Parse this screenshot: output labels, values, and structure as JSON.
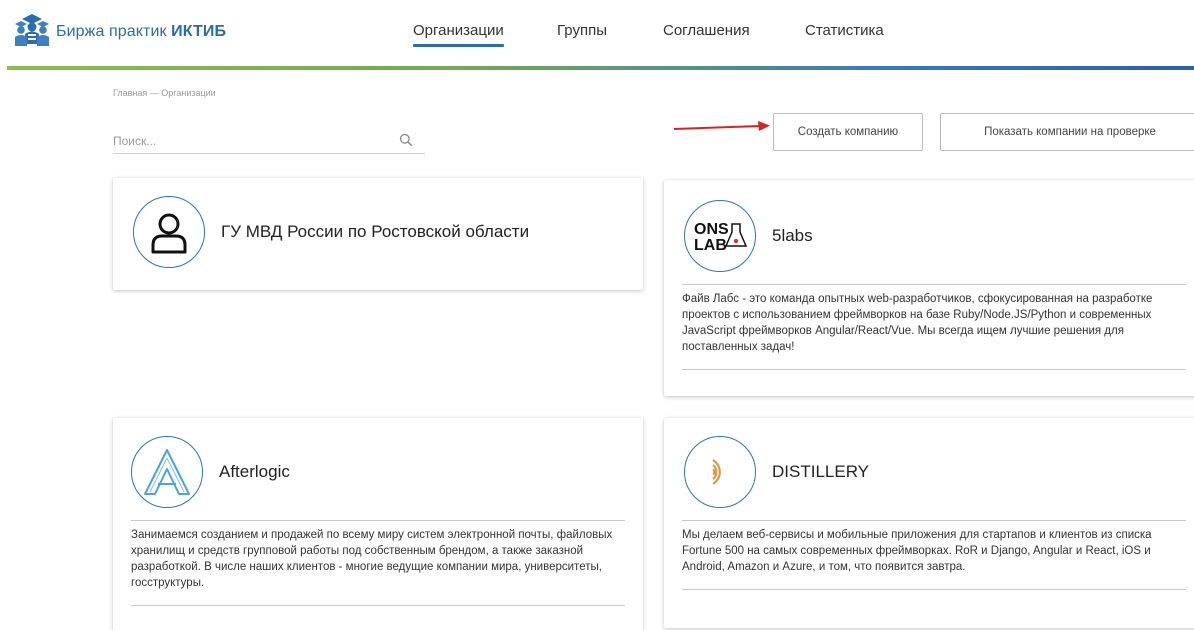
{
  "header": {
    "logo_text_regular": "Биржа практик ",
    "logo_text_bold": "ИКТИБ",
    "logo_icon": "students-group-icon",
    "nav": [
      {
        "label": "Организации",
        "active": true
      },
      {
        "label": "Группы",
        "active": false
      },
      {
        "label": "Соглашения",
        "active": false
      },
      {
        "label": "Статистика",
        "active": false
      }
    ],
    "colors": {
      "brand": "#2b6cb0",
      "line_start": "#8bbf48",
      "line_end": "#2c5fa8"
    }
  },
  "breadcrumb": "Главная — Организации",
  "search": {
    "placeholder": "Поиск...",
    "value": "",
    "icon": "search-icon"
  },
  "actions": {
    "create_label": "Создать компанию",
    "show_review_label": "Показать компании на проверке",
    "arrow_color": "#e02020"
  },
  "organizations": [
    {
      "name": "ГУ МВД России по Ростовской области",
      "logo": "user-placeholder-icon",
      "description": ""
    },
    {
      "name": "5labs",
      "logo": "5labs-logo",
      "logo_text_top": "ONS",
      "logo_text_bottom": "LAB",
      "description": "Файв Лабс - это команда опытных web-разработчиков, сфокусированная на разработке проектов с использованием фреймворков на базе Ruby/Node.JS/Python и современных JavaScript фреймворков Angular/React/Vue. Мы всегда ищем лучшие решения для поставленных задач!"
    },
    {
      "name": "Afterlogic",
      "logo": "afterlogic-logo",
      "description": "Занимаемся созданием и продажей по всему миру систем электронной почты, файловых хранилищ и средств групповой работы под собственным брендом, а также заказной разработкой. В числе наших клиентов - многие ведущие компании мира, университеты, госструктуры."
    },
    {
      "name": "DISTILLERY",
      "logo": "distillery-logo",
      "description": "Мы делаем веб-сервисы и мобильные приложения для стартапов и клиентов из списка Fortune 500 на самых современных фреймворках. RoR и Django, Angular и React, iOS и Android, Amazon и Azure, и том, что появится завтра."
    }
  ]
}
